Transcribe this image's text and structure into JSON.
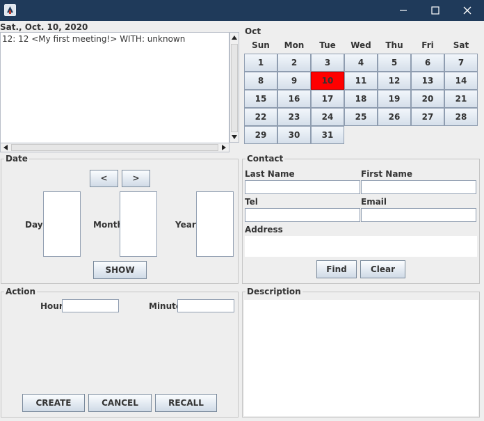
{
  "window": {
    "icons": {
      "app": "app-icon",
      "minimize": "minimize-icon",
      "maximize": "maximize-icon",
      "close": "close-icon"
    }
  },
  "agenda": {
    "date_header": "Sat., Oct. 10, 2020",
    "entries": [
      "12: 12 <My first meeting!> WITH: unknown"
    ]
  },
  "calendar": {
    "month": "Oct",
    "weekdays": [
      "Sun",
      "Mon",
      "Tue",
      "Wed",
      "Thu",
      "Fri",
      "Sat"
    ],
    "days": [
      "1",
      "2",
      "3",
      "4",
      "5",
      "6",
      "7",
      "8",
      "9",
      "10",
      "11",
      "12",
      "13",
      "14",
      "15",
      "16",
      "17",
      "18",
      "19",
      "20",
      "21",
      "22",
      "23",
      "24",
      "25",
      "26",
      "27",
      "28",
      "29",
      "30",
      "31"
    ],
    "selected_day": "10",
    "selected_color": "#ff0000"
  },
  "date_panel": {
    "title": "Date",
    "prev_label": "<",
    "next_label": ">",
    "day_label": "Day",
    "month_label": "Month",
    "year_label": "Year",
    "show_label": "SHOW"
  },
  "contact_panel": {
    "title": "Contact",
    "last_name_label": "Last Name",
    "first_name_label": "First Name",
    "tel_label": "Tel",
    "email_label": "Email",
    "address_label": "Address",
    "last_name_value": "",
    "first_name_value": "",
    "tel_value": "",
    "email_value": "",
    "address_value": "",
    "find_label": "Find",
    "clear_label": "Clear"
  },
  "action_panel": {
    "title": "Action",
    "hour_label": "Hour",
    "minute_label": "Minute",
    "hour_value": "",
    "minute_value": "",
    "create_label": "CREATE",
    "cancel_label": "CANCEL",
    "recall_label": "RECALL"
  },
  "description_panel": {
    "title": "Description",
    "value": ""
  }
}
